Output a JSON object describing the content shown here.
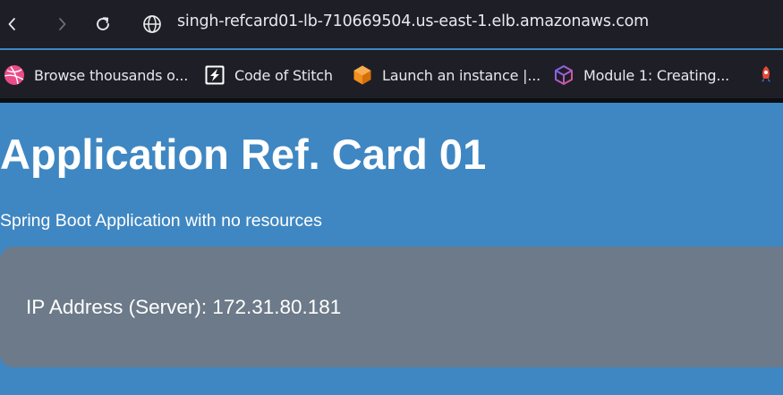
{
  "browser": {
    "url": "singh-refcard01-lb-710669504.us-east-1.elb.amazonaws.com",
    "icons": {
      "back": "chevron-left-icon",
      "forward": "chevron-right-icon",
      "reload": "reload-icon",
      "site": "globe-icon"
    }
  },
  "bookmarks": [
    {
      "label": "Browse thousands o...",
      "icon": "dribbble-icon"
    },
    {
      "label": "Code of Stitch",
      "icon": "stitch-icon"
    },
    {
      "label": "Launch an instance |...",
      "icon": "aws-ec2-icon"
    },
    {
      "label": "Module 1: Creating...",
      "icon": "cube-icon"
    },
    {
      "label": "",
      "icon": "rocket-icon"
    }
  ],
  "page": {
    "title": "Application Ref. Card 01",
    "subtitle": "Spring Boot Application with no resources",
    "ip_text": "IP Address (Server): 172.31.80.181"
  },
  "colors": {
    "chrome_bg": "#1e1f26",
    "page_bg": "#3f87c2",
    "info_box_bg": "#6c7a89",
    "text_light": "#ffffff"
  }
}
